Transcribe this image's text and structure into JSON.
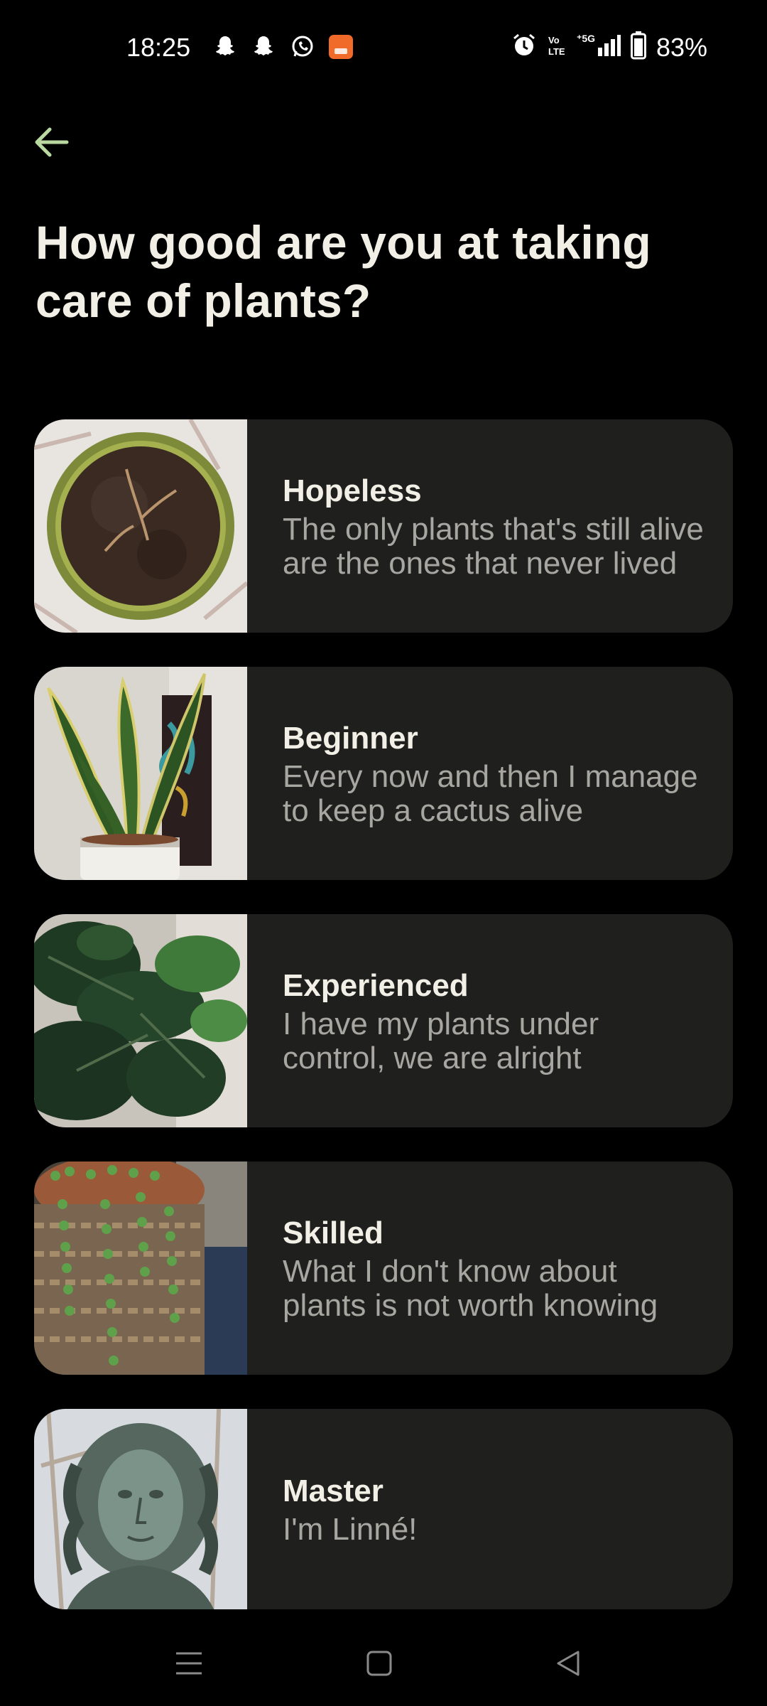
{
  "status_bar": {
    "time": "18:25",
    "left_icons": [
      "snapchat-icon",
      "snapchat-icon",
      "whatsapp-icon",
      "app-notification-icon"
    ],
    "right_icons": [
      "alarm-icon",
      "volte-icon",
      "signal-5g-icon",
      "battery-icon"
    ],
    "battery": "83%",
    "network": "5G",
    "volte": "Vo LTE"
  },
  "header": {
    "back_icon": "arrow-left-icon",
    "title": "How good are you at taking care of plants?"
  },
  "options": [
    {
      "title": "Hopeless",
      "description": "The only plants that's still alive are the ones that never lived",
      "image": "dry-soil-pot-image"
    },
    {
      "title": "Beginner",
      "description": "Every now and then I manage to keep a cactus alive",
      "image": "snake-plant-image"
    },
    {
      "title": "Experienced",
      "description": "I have my plants under control, we are alright",
      "image": "fiddle-leaf-fig-image"
    },
    {
      "title": "Skilled",
      "description": "What I don't know about plants is not worth knowing",
      "image": "string-of-pearls-image"
    },
    {
      "title": "Master",
      "description": "I'm Linné!",
      "image": "linnaeus-statue-image"
    }
  ],
  "nav": {
    "icons": [
      "menu-icon",
      "home-icon",
      "back-icon"
    ]
  },
  "colors": {
    "background": "#000000",
    "card": "#1f1f1e",
    "title_text": "#f1efe6",
    "desc_text": "#a7a6a0",
    "accent": "#b9d9a0"
  }
}
